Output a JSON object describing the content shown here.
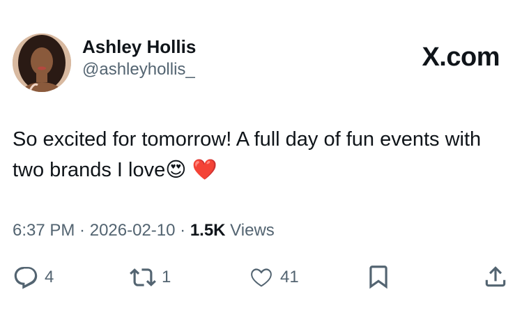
{
  "author": {
    "display_name": "Ashley Hollis",
    "handle": "@ashleyhollis_"
  },
  "brand": {
    "label": "X.com"
  },
  "tweet": {
    "text": "So excited for tomorrow! A full day of fun events with two brands I love😍 ❤️"
  },
  "meta": {
    "time": "6:37 PM",
    "separator": " · ",
    "date": "2026-02-10",
    "views_count": "1.5K",
    "views_label": " Views"
  },
  "actions": {
    "reply": {
      "icon": "reply-icon",
      "count": "4"
    },
    "repost": {
      "icon": "repost-icon",
      "count": "1"
    },
    "like": {
      "icon": "heart-icon",
      "count": "41"
    },
    "bookmark": {
      "icon": "bookmark-icon"
    },
    "share": {
      "icon": "share-icon"
    }
  },
  "colors": {
    "text_primary": "#0f1419",
    "text_secondary": "#536471",
    "background": "#ffffff"
  }
}
